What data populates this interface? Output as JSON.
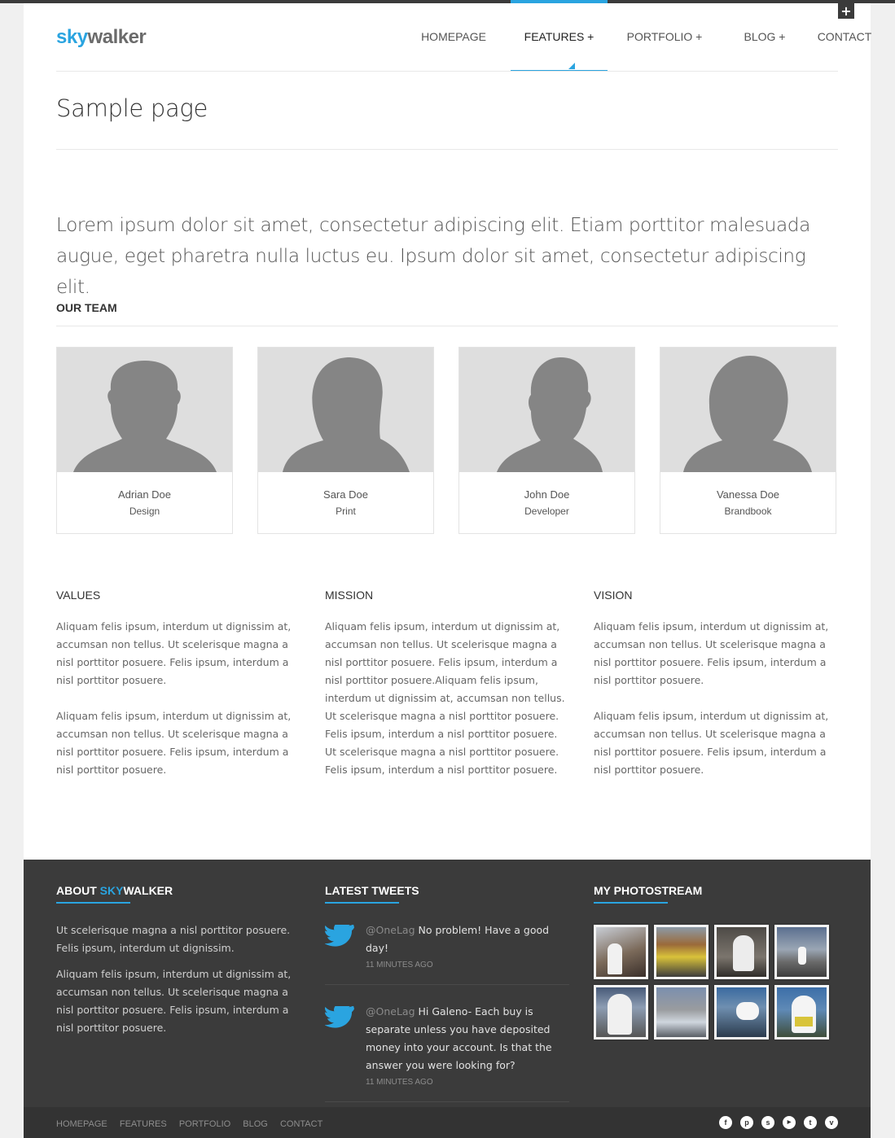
{
  "header": {
    "logo_sky": "sky",
    "logo_walker": "walker",
    "nav": [
      {
        "label": "HOMEPAGE"
      },
      {
        "label": "FEATURES +"
      },
      {
        "label": "PORTFOLIO +"
      },
      {
        "label": "BLOG +"
      },
      {
        "label": "CONTACT"
      }
    ],
    "active_nav": "FEATURES +",
    "plus_button": "+"
  },
  "page": {
    "title": "Sample page",
    "intro": "Lorem ipsum dolor sit amet, consectetur adipiscing elit. Etiam porttitor malesuada augue, eget pharetra nulla luctus eu. Ipsum dolor sit amet, consectetur adipiscing elit."
  },
  "team": {
    "heading": "OUR TEAM",
    "members": [
      {
        "name": "Adrian Doe",
        "role": "Design"
      },
      {
        "name": "Sara Doe",
        "role": "Print"
      },
      {
        "name": "John Doe",
        "role": "Developer"
      },
      {
        "name": "Vanessa Doe",
        "role": "Brandbook"
      }
    ]
  },
  "columns": [
    {
      "title": "VALUES",
      "paragraphs": [
        "Aliquam felis ipsum, interdum ut dignissim at, accumsan non tellus. Ut scelerisque magna a nisl porttitor posuere. Felis ipsum, interdum a nisl porttitor posuere.",
        "Aliquam felis ipsum, interdum ut dignissim at, accumsan non tellus. Ut scelerisque magna a nisl porttitor posuere. Felis ipsum, interdum a nisl porttitor posuere."
      ]
    },
    {
      "title": "MISSION",
      "paragraphs": [
        "Aliquam felis ipsum, interdum ut dignissim at, accumsan non tellus. Ut scelerisque magna a nisl porttitor posuere. Felis ipsum, interdum a nisl porttitor posuere.Aliquam felis ipsum, interdum ut dignissim at, accumsan non tellus. Ut scelerisque magna a nisl porttitor posuere. Felis ipsum, interdum a nisl porttitor posuere. Ut scelerisque magna a nisl porttitor posuere. Felis ipsum, interdum a nisl porttitor posuere."
      ]
    },
    {
      "title": "VISION",
      "paragraphs": [
        "Aliquam felis ipsum, interdum ut dignissim at, accumsan non tellus. Ut scelerisque magna a nisl porttitor posuere. Felis ipsum, interdum a nisl porttitor posuere.",
        "Aliquam felis ipsum, interdum ut dignissim at, accumsan non tellus. Ut scelerisque magna a nisl porttitor posuere. Felis ipsum, interdum a nisl porttitor posuere."
      ]
    }
  ],
  "footer": {
    "about": {
      "title_prefix": "ABOUT ",
      "title_sky": "SKY",
      "title_rest": "WALKER",
      "paragraphs": [
        "Ut scelerisque magna a nisl porttitor posuere. Felis ipsum, interdum ut dignissim.",
        "Aliquam felis ipsum, interdum ut dignissim at, accumsan non tellus. Ut scelerisque magna a nisl porttitor posuere. Felis ipsum, interdum a nisl porttitor posuere."
      ]
    },
    "tweets": {
      "title": "LATEST TWEETS",
      "items": [
        {
          "handle": "@OneLag",
          "text": " No problem! Have a good day!",
          "time": "11 MINUTES AGO"
        },
        {
          "handle": "@OneLag",
          "text": " Hi Galeno- Each buy is separate unless you have deposited money into your account. Is that the answer you were looking for?",
          "time": "11 MINUTES AGO"
        }
      ]
    },
    "photostream": {
      "title": "MY PHOTOSTREAM",
      "count": 8
    },
    "bottom_links": [
      "HOMEPAGE",
      "FEATURES",
      "PORTFOLIO",
      "BLOG",
      "CONTACT"
    ],
    "social_icons": [
      "facebook-icon",
      "pinterest-icon",
      "skype-icon",
      "youtube-icon",
      "twitter-icon",
      "vimeo-icon"
    ]
  },
  "colors": {
    "accent": "#2aa4e0",
    "footer_bg": "#3b3b3b",
    "bottom_bar_bg": "#333333"
  }
}
